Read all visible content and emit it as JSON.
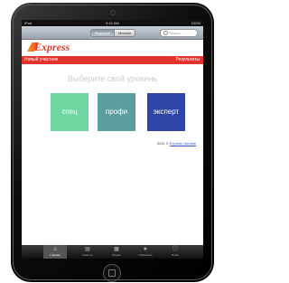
{
  "statusbar": {
    "carrier": "iPad",
    "time": "9:41 AM",
    "battery": "100%"
  },
  "navbar": {
    "segments": [
      "Ведущий",
      "Мнение"
    ],
    "search_placeholder": "Search"
  },
  "logo": {
    "text": "Express"
  },
  "redbar": {
    "left": "Новый участник",
    "right": "Результаты"
  },
  "heading": "Выберите свой уровень",
  "levels": [
    {
      "label": "спец"
    },
    {
      "label": "профи"
    },
    {
      "label": "эксперт"
    }
  ],
  "copyright": {
    "year": "2011 ©",
    "link": "Express Ukraine"
  },
  "tabbar": {
    "items": [
      {
        "label": "Главная",
        "icon": "home-icon"
      },
      {
        "label": "Новости",
        "icon": "news-icon"
      },
      {
        "label": "Медиа",
        "icon": "media-icon"
      },
      {
        "label": "Избранное",
        "icon": "star-icon"
      },
      {
        "label": "Инфо",
        "icon": "info-icon"
      }
    ]
  },
  "colors": {
    "red": "#e2342c",
    "spec": "#6ed6a1",
    "profi": "#5b9ea0",
    "expert": "#2e45a8"
  }
}
